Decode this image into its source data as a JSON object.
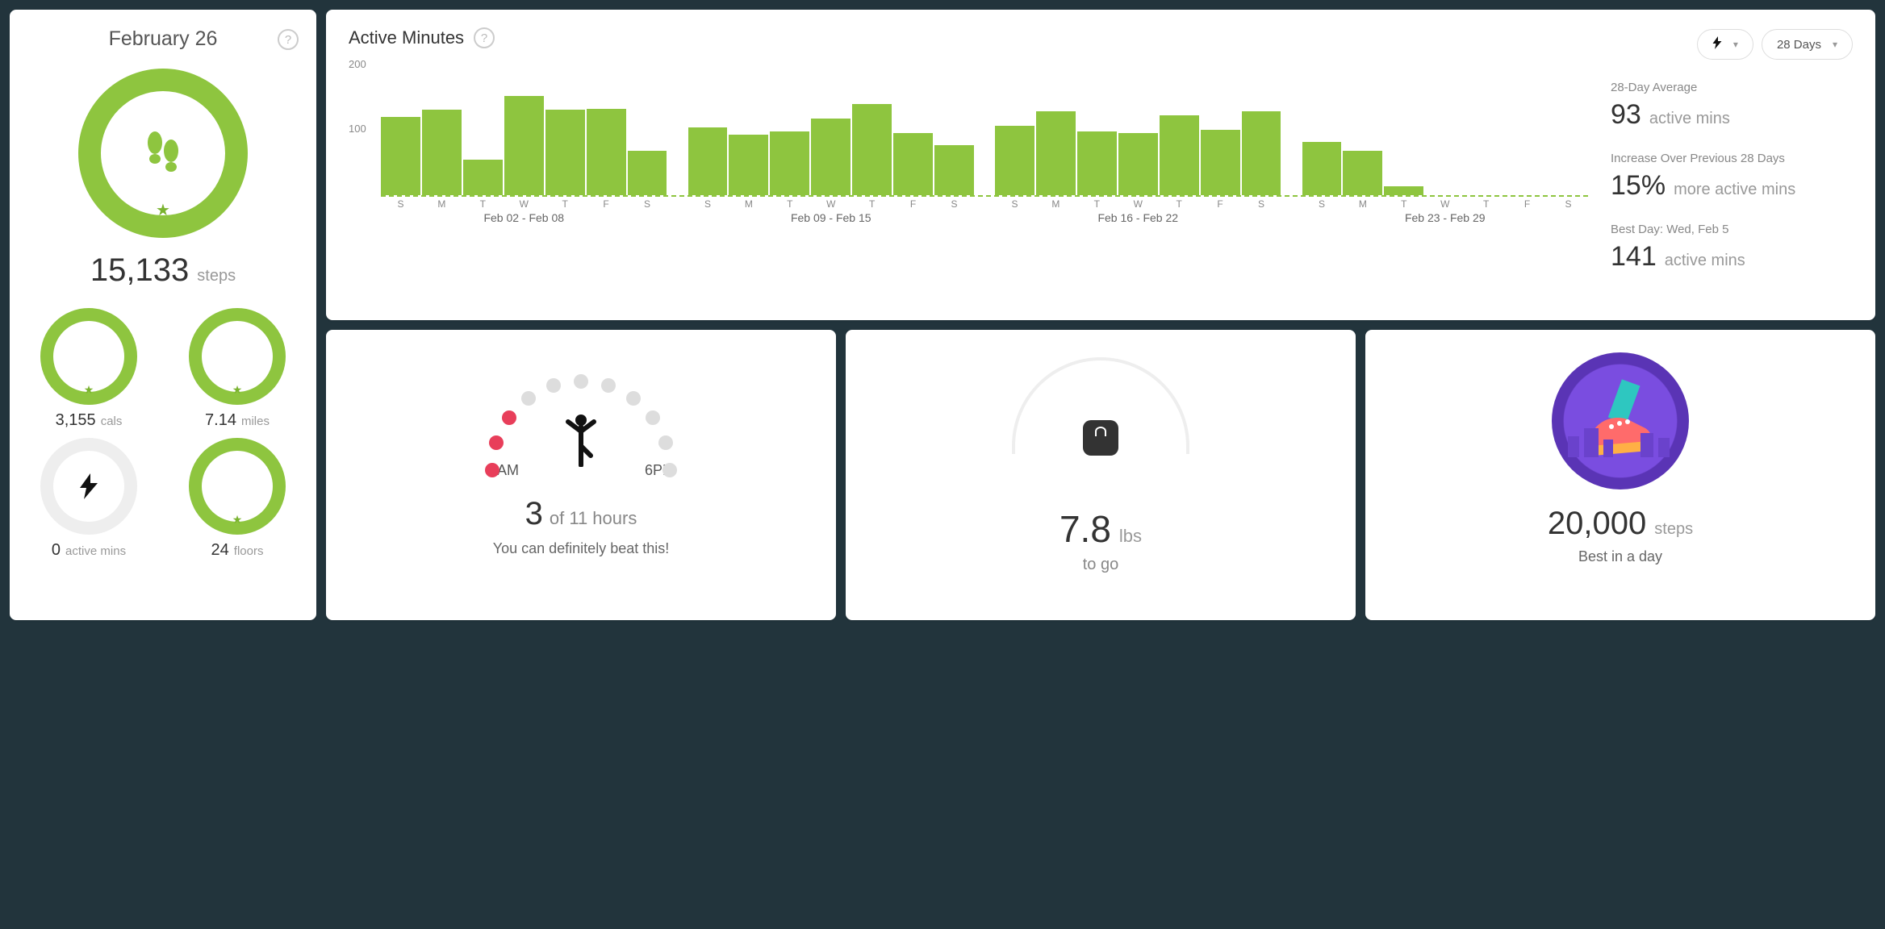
{
  "daily": {
    "date": "February 26",
    "steps_value": "15,133",
    "steps_unit": "steps",
    "cals_value": "3,155",
    "cals_unit": "cals",
    "miles_value": "7.14",
    "miles_unit": "miles",
    "active_value": "0",
    "active_unit": "active mins",
    "floors_value": "24",
    "floors_unit": "floors"
  },
  "active_minutes": {
    "title": "Active Minutes",
    "axis_200": "200",
    "axis_100": "100",
    "range_selector_label": "28 Days",
    "avg_label": "28-Day Average",
    "avg_value": "93",
    "avg_unit": "active mins",
    "increase_label": "Increase Over Previous 28 Days",
    "increase_value": "15%",
    "increase_unit": "more active mins",
    "best_label": "Best Day: Wed, Feb 5",
    "best_value": "141",
    "best_unit": "active mins"
  },
  "chart_data": {
    "type": "bar",
    "title": "Active Minutes",
    "xlabel": "",
    "ylabel": "",
    "ylim": [
      0,
      200
    ],
    "axis_ticks_y": [
      100,
      200
    ],
    "day_letters": [
      "S",
      "M",
      "T",
      "W",
      "T",
      "F",
      "S"
    ],
    "groups": [
      {
        "range": "Feb 02 - Feb 08",
        "values": [
          110,
          120,
          50,
          140,
          120,
          122,
          62
        ]
      },
      {
        "range": "Feb 09 - Feb 15",
        "values": [
          95,
          85,
          90,
          108,
          128,
          88,
          70
        ]
      },
      {
        "range": "Feb 16 - Feb 22",
        "values": [
          98,
          118,
          90,
          88,
          112,
          92,
          118
        ]
      },
      {
        "range": "Feb 23 - Feb 29",
        "values": [
          75,
          62,
          12,
          0,
          0,
          0,
          0
        ]
      }
    ]
  },
  "hourly": {
    "start_label": "7AM",
    "end_label": "6PM",
    "count": "3",
    "of_text": "of 11 hours",
    "message": "You can definitely beat this!",
    "dots": [
      true,
      true,
      true,
      false,
      false,
      false,
      false,
      false,
      false,
      false,
      false
    ]
  },
  "weight": {
    "value": "7.8",
    "unit": "lbs",
    "sub": "to go"
  },
  "badge": {
    "value": "20,000",
    "unit": "steps",
    "sub": "Best in a day"
  }
}
